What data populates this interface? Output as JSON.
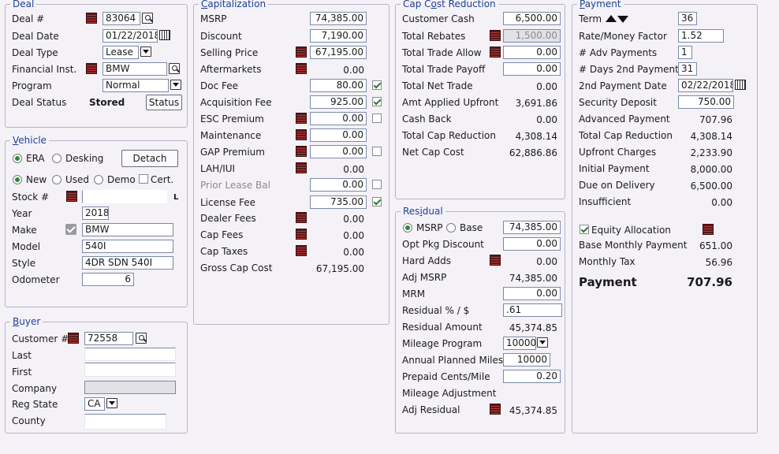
{
  "deal": {
    "legend": "Deal",
    "deal_no_label": "Deal #",
    "deal_no": "83064",
    "deal_date_label": "Deal Date",
    "deal_date": "01/22/2018",
    "deal_type_label": "Deal Type",
    "deal_type": "Lease",
    "fin_inst_label": "Financial Inst.",
    "fin_inst": "BMW",
    "program_label": "Program",
    "program": "Normal",
    "status_label": "Deal Status",
    "status": "Stored",
    "status_button": "Status"
  },
  "vehicle": {
    "legend_first": "V",
    "legend_rest": "ehicle",
    "era": "ERA",
    "desking": "Desking",
    "detach": "Detach",
    "new": "New",
    "used": "Used",
    "demo": "Demo",
    "cert": "Cert.",
    "stock_label": "Stock #",
    "stock_suffix": "L",
    "year_label": "Year",
    "year": "2018",
    "make_label": "Make",
    "make": "BMW",
    "model_label": "Model",
    "model": "540I",
    "style_label": "Style",
    "style": "4DR SDN 540I",
    "odometer_label": "Odometer",
    "odometer": "6"
  },
  "buyer": {
    "legend_first": "B",
    "legend_rest": "uyer",
    "customer_label": "Customer #",
    "customer": "72558",
    "last_label": "Last",
    "first_label": "First",
    "company_label": "Company",
    "reg_state_label": "Reg State",
    "reg_state": "CA",
    "county_label": "County"
  },
  "cap": {
    "legend_first": "C",
    "legend_rest": "apitalization",
    "msrp_label": "MSRP",
    "msrp": "74,385.00",
    "discount_label": "Discount",
    "discount": "7,190.00",
    "selling_label": "Selling Price",
    "selling": "67,195.00",
    "aftermarkets_label": "Aftermarkets",
    "aftermarkets": "0.00",
    "doc_fee_label": "Doc Fee",
    "doc_fee": "80.00",
    "acq_fee_label": "Acquisition Fee",
    "acq_fee": "925.00",
    "esc_label": "ESC Premium",
    "esc": "0.00",
    "maint_label": "Maintenance",
    "maint": "0.00",
    "gap_label": "GAP Premium",
    "gap": "0.00",
    "lah_label": "LAH/IUI",
    "lah": "0.00",
    "prior_label": "Prior Lease Bal",
    "prior": "0.00",
    "license_label": "License Fee",
    "license": "735.00",
    "dealer_fees_label": "Dealer Fees",
    "dealer_fees": "0.00",
    "cap_fees_label": "Cap Fees",
    "cap_fees": "0.00",
    "cap_taxes_label": "Cap Taxes",
    "cap_taxes": "0.00",
    "gross_label": "Gross Cap Cost",
    "gross": "67,195.00"
  },
  "ccr": {
    "legend_pre": "Cap C",
    "legend_first": "o",
    "legend_rest": "st Reduction",
    "cust_cash_label": "Customer Cash",
    "cust_cash": "6,500.00",
    "rebates_label": "Total Rebates",
    "rebates": "1,500.00",
    "trade_allow_label": "Total Trade Allow",
    "trade_allow": "0.00",
    "trade_payoff_label": "Total Trade Payoff",
    "trade_payoff": "0.00",
    "net_trade_label": "Total Net Trade",
    "net_trade": "0.00",
    "amt_upfront_label": "Amt Applied Upfront",
    "amt_upfront": "3,691.86",
    "cash_back_label": "Cash Back",
    "cash_back": "0.00",
    "total_ccr_label": "Total Cap Reduction",
    "total_ccr": "4,308.14",
    "net_cap_label": "Net Cap Cost",
    "net_cap": "62,886.86"
  },
  "residual": {
    "legend_pre": "Res",
    "legend_first": "i",
    "legend_rest": "dual",
    "msrp_radio": "MSRP",
    "base_radio": "Base",
    "msrp_value": "74,385.00",
    "opt_pkg_label": "Opt Pkg Discount",
    "opt_pkg": "0.00",
    "hard_adds_label": "Hard Adds",
    "hard_adds": "0.00",
    "adj_msrp_label": "Adj MSRP",
    "adj_msrp": "74,385.00",
    "mrm_label": "MRM",
    "mrm": "0.00",
    "pct_label": "Residual % / $",
    "pct": ".61",
    "amount_label": "Residual Amount",
    "amount": "45,374.85",
    "mileage_prog_label": "Mileage Program",
    "mileage_prog": "10000",
    "annual_label": "Annual Planned Miles",
    "annual": "10000",
    "cents_label": "Prepaid Cents/Mile",
    "cents": "0.20",
    "mileage_adj_label": "Mileage Adjustment",
    "adj_resid_label": "Adj Residual",
    "adj_resid": "45,374.85"
  },
  "payment": {
    "legend_first": "P",
    "legend_rest": "ayment",
    "term_label": "Term",
    "term": "36",
    "rate_label": "Rate/Money Factor",
    "rate": "1.52",
    "adv_label": "# Adv Payments",
    "adv": "1",
    "days_label": "# Days 2nd Payment",
    "days": "31",
    "second_date_label": "2nd Payment Date",
    "second_date": "02/22/2018",
    "deposit_label": "Security Deposit",
    "deposit": "750.00",
    "adv_pay_label": "Advanced Payment",
    "adv_pay": "707.96",
    "total_ccr_label": "Total Cap Reduction",
    "total_ccr": "4,308.14",
    "upfront_label": "Upfront Charges",
    "upfront": "2,233.90",
    "initial_label": "Initial Payment",
    "initial": "8,000.00",
    "due_label": "Due on Delivery",
    "due": "6,500.00",
    "insufficient_label": "Insufficient",
    "insufficient": "0.00",
    "equity_label": "Equity Allocation",
    "base_monthly_label": "Base Monthly Payment",
    "base_monthly": "651.00",
    "monthly_tax_label": "Monthly Tax",
    "monthly_tax": "56.96",
    "payment_label": "Payment",
    "payment": "707.96"
  }
}
